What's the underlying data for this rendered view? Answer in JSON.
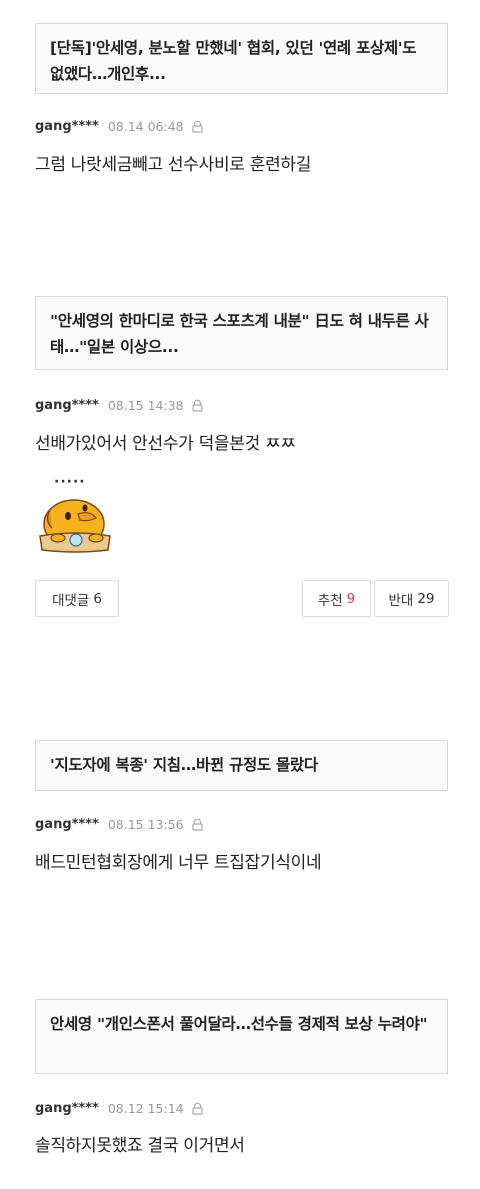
{
  "comments": [
    {
      "article_title": "[단독]'안세영, 분노할 만했네' 협회, 있던 '연례 포상제'도 없앴다…개인후...",
      "user": "gang****",
      "date": "08.14 06:48",
      "text": "그럼 나랏세금빼고 선수사비로 훈련하길"
    },
    {
      "article_title": "\"안세영의 한마디로 한국 스포츠계 내분\" 日도 혀 내두른 사태…\"일본 이상으...",
      "user": "gang****",
      "date": "08.15 14:38",
      "text": "선배가있어서 안선수가 덕을본것 ㅉㅉ",
      "sticker_dots": "·····",
      "buttons": {
        "reply_label": "대댓글",
        "reply_count": "6",
        "like_label": "추천",
        "like_count": "9",
        "dislike_label": "반대",
        "dislike_count": "29"
      }
    },
    {
      "article_title": "'지도자에 복종' 지침…바뀐 규정도 몰랐다",
      "user": "gang****",
      "date": "08.15 13:56",
      "text": "배드민턴협회장에게 너무 트집잡기식이네"
    },
    {
      "article_title": "안세영 \"개인스폰서 풀어달라…선수들 경제적 보상 누려야\"",
      "user": "gang****",
      "date": "08.12 15:14",
      "text": "솔직하지못했죠 결국 이거면서"
    }
  ],
  "colors": {
    "like_count": "#d33d3d",
    "border": "#d9d9d9",
    "box_bg": "#fafafa",
    "meta": "#999999"
  }
}
